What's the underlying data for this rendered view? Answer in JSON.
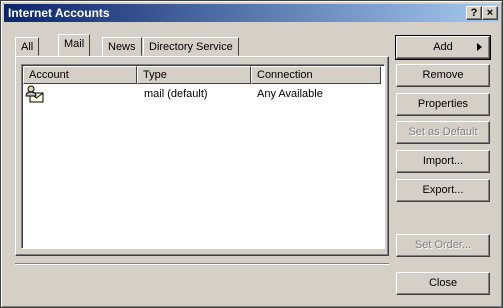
{
  "window": {
    "title": "Internet Accounts",
    "help_label": "?",
    "close_label": "×"
  },
  "tabs": [
    {
      "label": "All"
    },
    {
      "label": "Mail"
    },
    {
      "label": "News"
    },
    {
      "label": "Directory Service"
    }
  ],
  "active_tab": "Mail",
  "list": {
    "columns": [
      "Account",
      "Type",
      "Connection"
    ],
    "rows": [
      {
        "account": "",
        "type": "mail (default)",
        "connection": "Any Available"
      }
    ]
  },
  "buttons": {
    "add": "Add",
    "remove": "Remove",
    "properties": "Properties",
    "set_default": "Set as Default",
    "import": "Import...",
    "export": "Export...",
    "set_order": "Set Order...",
    "close": "Close"
  }
}
